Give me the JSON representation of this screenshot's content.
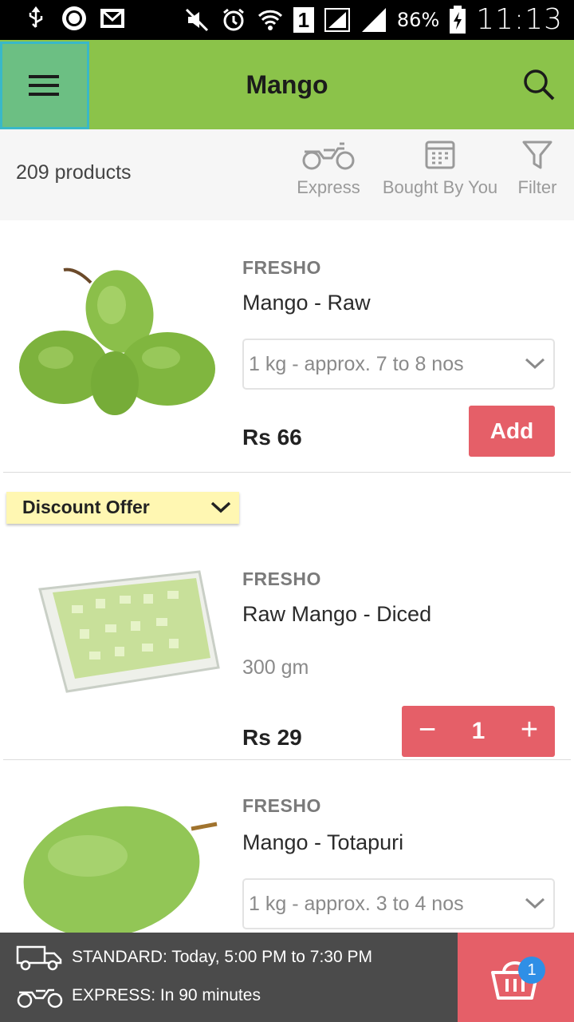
{
  "status_bar": {
    "battery_percent": "86%",
    "time": "11:13",
    "sim_label": "1"
  },
  "app_bar": {
    "title": "Mango",
    "menu_icon": "hamburger-icon",
    "search_icon": "search-icon"
  },
  "filters": {
    "product_count": "209 products",
    "options": [
      {
        "label": "Express",
        "icon": "motorcycle-icon"
      },
      {
        "label": "Bought By You",
        "icon": "calendar-icon"
      },
      {
        "label": "Filter",
        "icon": "funnel-icon"
      }
    ]
  },
  "products": [
    {
      "brand": "FRESHO",
      "name": "Mango - Raw",
      "pack": "1 kg - approx. 7 to 8 nos",
      "price": "Rs 66",
      "action": "Add"
    },
    {
      "offer": "Discount Offer",
      "brand": "FRESHO",
      "name": "Raw Mango - Diced",
      "pack": "300 gm",
      "price": "Rs 29",
      "quantity": "1",
      "minus": "−",
      "plus": "+"
    },
    {
      "brand": "FRESHO",
      "name": "Mango - Totapuri",
      "pack": "1 kg - approx. 3 to 4 nos"
    }
  ],
  "delivery": {
    "standard": "STANDARD: Today, 5:00 PM to 7:30 PM",
    "express": "EXPRESS: In 90 minutes",
    "cart_count": "1"
  },
  "colors": {
    "app_bar": "#8bc34a",
    "accent": "#e55f68",
    "offer_bg": "#fff7b2",
    "badge": "#2f8fe6"
  }
}
